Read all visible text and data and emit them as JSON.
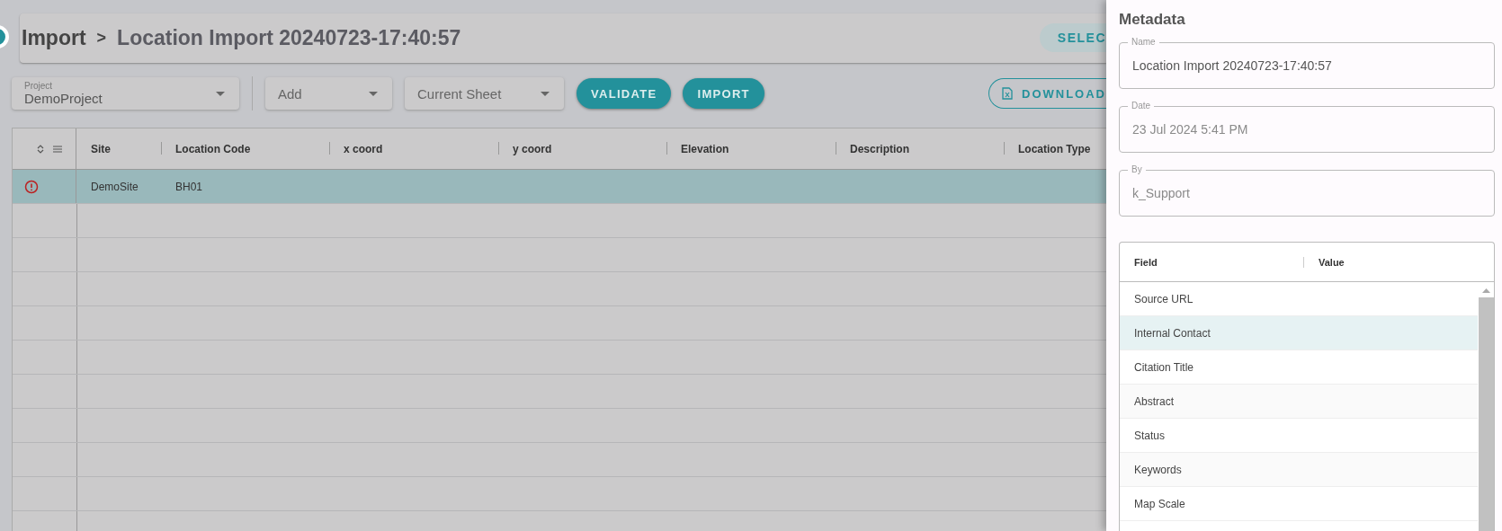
{
  "header": {
    "breadcrumb": "Import",
    "separator": ">",
    "title": "Location Import 20240723-17:40:57",
    "select_button": "SELEC"
  },
  "toolbar": {
    "project": {
      "label": "Project",
      "value": "DemoProject"
    },
    "add": {
      "placeholder": "Add"
    },
    "sheet": {
      "value": "Current Sheet"
    },
    "buttons": [
      "VALIDATE",
      "IMPORT"
    ],
    "download_button": "DOWNLOAD"
  },
  "grid": {
    "columns": [
      "Site",
      "Location Code",
      "x coord",
      "y coord",
      "Elevation",
      "Description",
      "Location Type"
    ],
    "rows": [
      {
        "error": true,
        "selected": true,
        "cells": [
          "DemoSite",
          "BH01"
        ]
      }
    ]
  },
  "metadata": {
    "title": "Metadata",
    "fields": [
      {
        "label": "Name",
        "value": "Location Import 20240723-17:40:57",
        "disabled": false
      },
      {
        "label": "Date",
        "value": "23 Jul 2024 5:41 PM",
        "disabled": true
      },
      {
        "label": "By",
        "value": "k_Support",
        "disabled": true
      }
    ],
    "table": {
      "columns": [
        "Field",
        "Value"
      ],
      "rows": [
        {
          "field": "Source URL",
          "selected": false
        },
        {
          "field": "Internal Contact",
          "selected": true
        },
        {
          "field": "Citation Title",
          "selected": false
        },
        {
          "field": "Abstract",
          "selected": false
        },
        {
          "field": "Status",
          "selected": false
        },
        {
          "field": "Keywords",
          "selected": false
        },
        {
          "field": "Map Scale",
          "selected": false
        }
      ]
    }
  }
}
